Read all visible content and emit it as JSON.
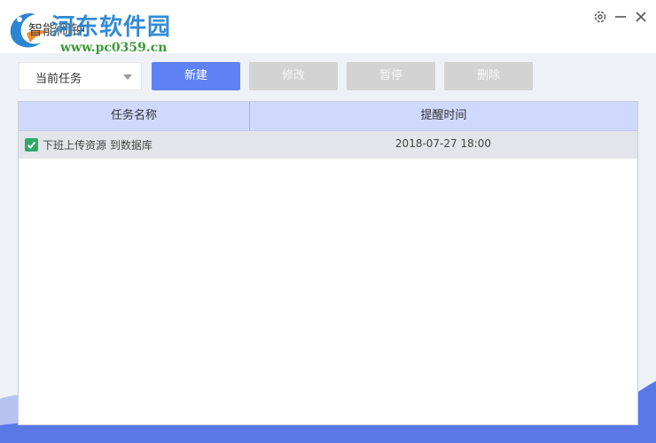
{
  "window": {
    "title": "智能闹钟",
    "watermark": {
      "name": "河东软件园",
      "url": "www.pc0359.cn"
    }
  },
  "toolbar": {
    "filter_selected": "当前任务",
    "new_label": "新建",
    "edit_label": "修改",
    "pause_label": "暂停",
    "delete_label": "删除"
  },
  "table": {
    "columns": [
      "任务名称",
      "提醒时间"
    ],
    "rows": [
      {
        "checked": true,
        "name": "下班上传资源 到数据库",
        "time": "2018-07-27 18:00"
      }
    ]
  },
  "colors": {
    "primary": "#5e82f4",
    "header_bg": "#cfd9fb",
    "row_bg": "#e3e5ea",
    "checkbox": "#2fa96a",
    "wave": "#5a78e6"
  }
}
